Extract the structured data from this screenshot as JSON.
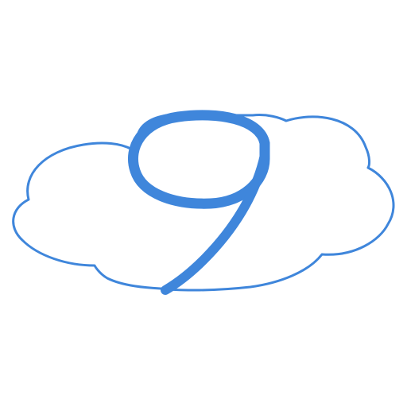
{
  "logo": {
    "icon": "cloud-nine-logo",
    "accent_color": "#3f86db",
    "fill_color": "#ffffff",
    "background_color": "#ffffff"
  }
}
